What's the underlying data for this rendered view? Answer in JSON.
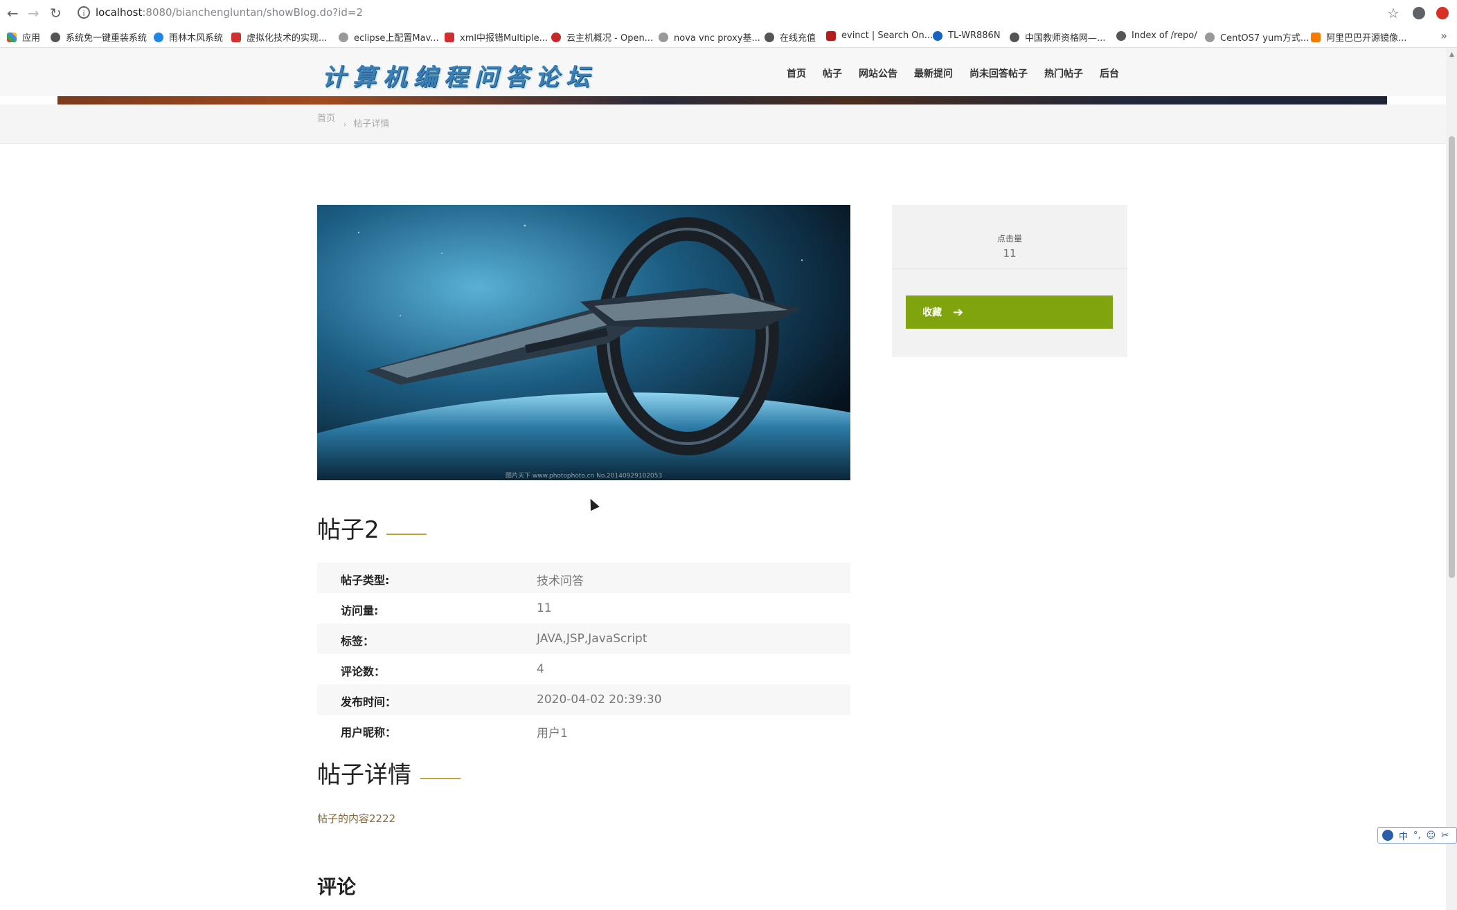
{
  "browser": {
    "url_host": "localhost",
    "url_path": ":8080/bianchengluntan/showBlog.do?id=2",
    "bookmarks": [
      {
        "label": "应用",
        "color": "#1a73e8"
      },
      {
        "label": "系统免一键重装系统",
        "color": "#555555"
      },
      {
        "label": "雨林木风系统",
        "color": "#1e88e5"
      },
      {
        "label": "虚拟化技术的实现...",
        "color": "#d32f2f"
      },
      {
        "label": "eclipse上配置Mav...",
        "color": "#666666"
      },
      {
        "label": "xml中报错Multiple...",
        "color": "#d32f2f"
      },
      {
        "label": "云主机概况 - Open...",
        "color": "#c62828"
      },
      {
        "label": "nova vnc proxy基...",
        "color": "#666666"
      },
      {
        "label": "在线充值",
        "color": "#555555"
      },
      {
        "label": "evinct | Search On...",
        "color": "#b71c1c"
      },
      {
        "label": "TL-WR886N",
        "color": "#1565c0"
      },
      {
        "label": "中国教师资格网—...",
        "color": "#555555"
      },
      {
        "label": "Index of /repo/",
        "color": "#555555"
      },
      {
        "label": "CentOS7 yum方式...",
        "color": "#666666"
      },
      {
        "label": "阿里巴巴开源镜像...",
        "color": "#f57c00"
      }
    ]
  },
  "site": {
    "logo": "计算机编程问答论坛",
    "nav": [
      "首页",
      "帖子",
      "网站公告",
      "最新提问",
      "尚未回答帖子",
      "热门帖子",
      "后台"
    ],
    "breadcrumb": {
      "home": "首页",
      "sep": "›",
      "current": "帖子详情"
    }
  },
  "side": {
    "click_label": "点击量",
    "click_value": "11",
    "fav_label": "收藏",
    "fav_arrow": "➔"
  },
  "post": {
    "title": "帖子2",
    "image_credit": "图片天下 www.photophoto.cn No.20140929102053",
    "info": [
      {
        "label": "帖子类型:",
        "value": "技术问答"
      },
      {
        "label": "访问量:",
        "value": "11"
      },
      {
        "label": "标签：",
        "value": "JAVA,JSP,JavaScript"
      },
      {
        "label": "评论数：",
        "value": "4"
      },
      {
        "label": "发布时间：",
        "value": "2020-04-02 20:39:30"
      },
      {
        "label": "用户昵称：",
        "value": "用户1"
      }
    ],
    "detail_title": "帖子详情",
    "content": "帖子的内容2222",
    "comment_title": "评论"
  },
  "ime": {
    "lang": "中"
  },
  "colors": {
    "accent_green": "#7fa40d",
    "title_underline": "#c9a13b"
  }
}
